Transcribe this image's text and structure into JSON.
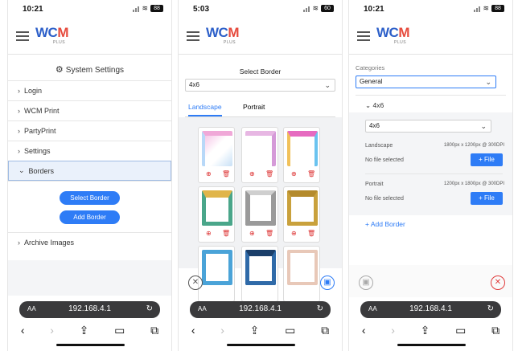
{
  "status": {
    "time1": "10:21",
    "time2": "5:03",
    "time3": "10:21",
    "battery1": "88",
    "battery2": "60",
    "battery3": "88"
  },
  "logo": {
    "brand_a": "WC",
    "brand_b": "M",
    "sub": "PLUS"
  },
  "panel1": {
    "title": "System Settings",
    "menu": [
      "Login",
      "WCM Print",
      "PartyPrint",
      "Settings",
      "Borders",
      "Archive Images"
    ],
    "select_border": "Select Border",
    "add_border": "Add Border"
  },
  "panel2": {
    "title": "Select Border",
    "size_value": "4x6",
    "tabs": [
      "Landscape",
      "Portrait"
    ]
  },
  "panel3": {
    "categories_label": "Categories",
    "category_value": "General",
    "size_section": "4x6",
    "size_value": "4x6",
    "landscape_label": "Landscape",
    "landscape_dims": "1800px x 1200px @ 300DPI",
    "no_file_1": "No file selected",
    "portrait_label": "Portrait",
    "portrait_dims": "1200px x 1800px @ 300DPI",
    "no_file_2": "No file selected",
    "file_btn": "+ File",
    "add_border": "Add Border"
  },
  "safari": {
    "aa": "AA",
    "url": "192.168.4.1"
  },
  "colors": {
    "accent": "#2e7cf6",
    "danger": "#d33333"
  },
  "icons": [
    "hamburger-icon",
    "gear-icon",
    "chevron-right-icon",
    "chevron-down-icon",
    "zoom-icon",
    "trash-icon",
    "close-icon",
    "save-icon",
    "reload-icon",
    "back-icon",
    "forward-icon",
    "share-icon",
    "bookmarks-icon",
    "tabs-icon"
  ]
}
